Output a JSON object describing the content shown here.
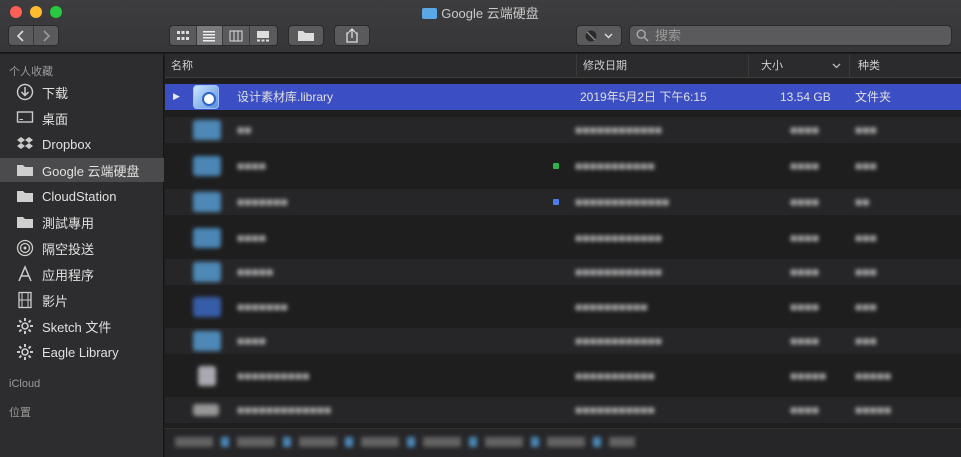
{
  "window": {
    "title": "Google 云端硬盘"
  },
  "toolbar": {
    "back_icon": "chevron-left-icon",
    "forward_icon": "chevron-right-icon",
    "view_modes": [
      "icon-view",
      "list-view",
      "column-view",
      "gallery-view"
    ],
    "active_view": "list-view",
    "search_placeholder": "搜索"
  },
  "sidebar": {
    "favorites_header": "个人收藏",
    "items": [
      {
        "label": "下载",
        "icon": "download-icon"
      },
      {
        "label": "桌面",
        "icon": "desktop-icon"
      },
      {
        "label": "Dropbox",
        "icon": "dropbox-icon"
      },
      {
        "label": "Google 云端硬盘",
        "icon": "folder-icon",
        "selected": true
      },
      {
        "label": "CloudStation",
        "icon": "folder-icon"
      },
      {
        "label": "測試專用",
        "icon": "folder-icon"
      },
      {
        "label": "隔空投送",
        "icon": "airdrop-icon"
      },
      {
        "label": "应用程序",
        "icon": "applications-icon"
      },
      {
        "label": "影片",
        "icon": "film-icon"
      },
      {
        "label": "Sketch 文件",
        "icon": "gear-icon"
      },
      {
        "label": "Eagle Library",
        "icon": "gear-icon"
      }
    ],
    "icloud_header": "iCloud",
    "locations_header": "位置"
  },
  "columns": {
    "name": "名称",
    "modified": "修改日期",
    "size": "大小",
    "kind": "种类"
  },
  "files": [
    {
      "name": "设计素材库.library",
      "modified": "2019年5月2日 下午6:15",
      "size": "13.54 GB",
      "kind": "文件夹",
      "selected": true
    },
    {
      "name": "■■",
      "modified": "■■■■■■■■■■■■",
      "size": "■■■■",
      "kind": "■■■"
    },
    {
      "name": "■■■■",
      "modified": "■■■■■■■■■■■",
      "size": "■■■■",
      "kind": "■■■"
    },
    {
      "name": "■■■■■■■",
      "modified": "■■■■■■■■■■■■■",
      "size": "■■■■",
      "kind": "■■"
    },
    {
      "name": "■■■■",
      "modified": "■■■■■■■■■■■■",
      "size": "■■■■",
      "kind": "■■■"
    },
    {
      "name": "■■■■■",
      "modified": "■■■■■■■■■■■■",
      "size": "■■■■",
      "kind": "■■■"
    },
    {
      "name": "■■■■■■■",
      "modified": "■■■■■■■■■■",
      "size": "■■■■",
      "kind": "■■■"
    },
    {
      "name": "■■■■",
      "modified": "■■■■■■■■■■■■",
      "size": "■■■■",
      "kind": "■■■"
    },
    {
      "name": "■■■■■■■■■■",
      "modified": "■■■■■■■■■■■",
      "size": "■■■■■",
      "kind": "■■■■■"
    },
    {
      "name": "■■■■■■■■■■■■■",
      "modified": "■■■■■■■■■■■",
      "size": "■■■■",
      "kind": "■■■■■"
    }
  ],
  "colors": {
    "selection": "#3b4ec4",
    "sidebar_bg": "#2d2d2f",
    "folder_blue": "#5aa9e6"
  }
}
